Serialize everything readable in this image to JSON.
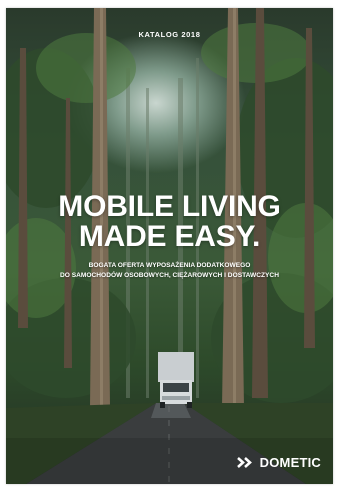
{
  "cover": {
    "catalog_label": "KATALOG 2018",
    "headline_line1": "MOBILE LIVING",
    "headline_line2": "MADE EASY.",
    "subline_line1": "BOGATA OFERTA WYPOSAŻENIA DODATKOWEGO",
    "subline_line2": "DO SAMOCHODÓW OSOBOWYCH, CIĘŻAROWYCH I DOSTAWCZYCH",
    "brand": "DOMETIC"
  },
  "colors": {
    "text": "#ffffff",
    "forest": "#35503a",
    "road": "#3a3d3e"
  },
  "icons": {
    "brand_logo": "dometic-chevron-logo"
  }
}
